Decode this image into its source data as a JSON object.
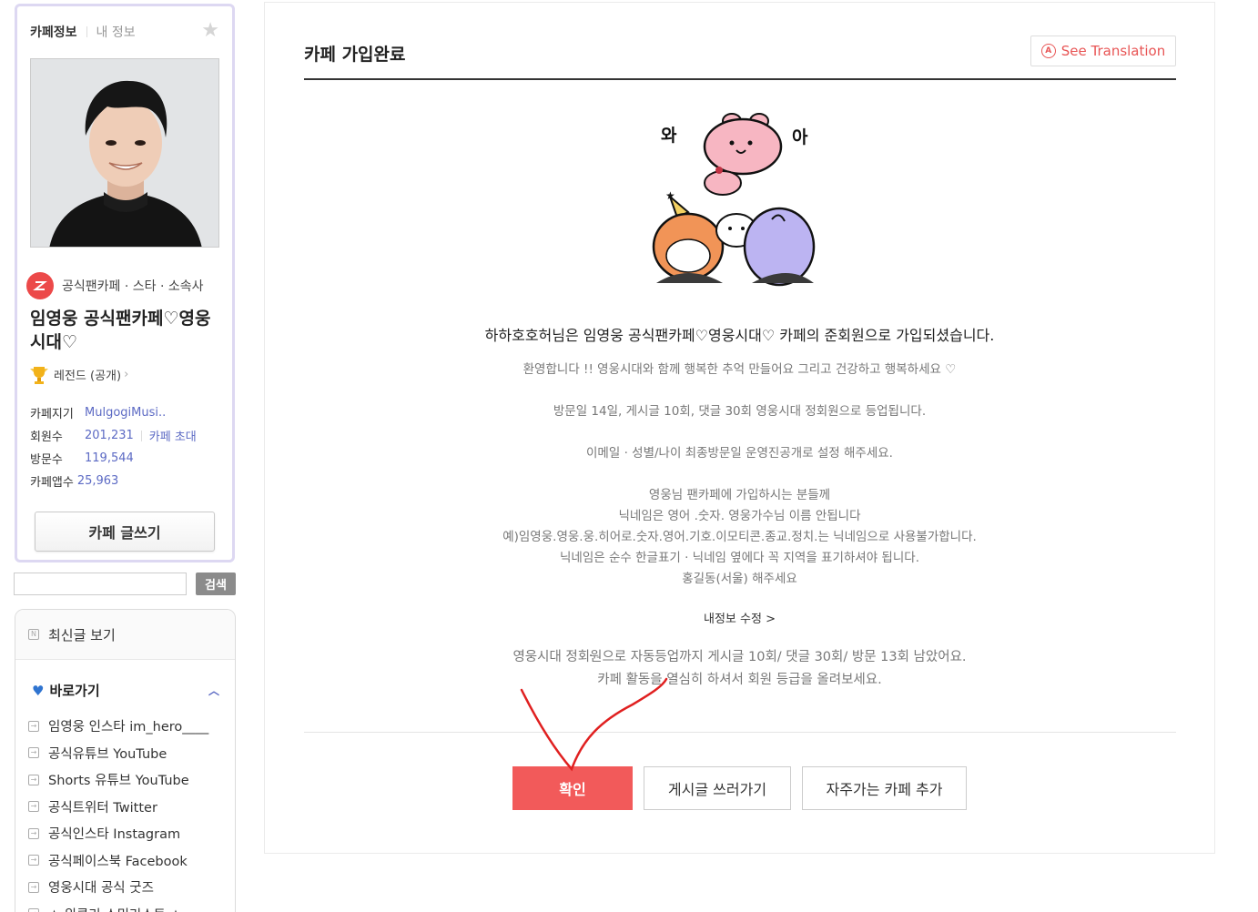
{
  "sidebar": {
    "tab_active": "카페정보",
    "tab_inactive": "내 정보",
    "category": "공식팬카페 · 스타 · 소속사",
    "cafe_name": "임영웅 공식팬카페♡영웅시대♡",
    "level": "레전드 (공개)",
    "stats": {
      "manager_label": "카페지기",
      "manager_value": "MulgogiMusi..",
      "members_label": "회원수",
      "members_value": "201,231",
      "invite_label": "카페 초대",
      "visits_label": "방문수",
      "visits_value": "119,544",
      "app_label": "카페앱수",
      "app_value": "25,963"
    },
    "write_button": "카페 글쓰기",
    "search_button": "검색",
    "search_value": "",
    "recent_posts": "최신글 보기",
    "shortcut_title": "바로가기",
    "shortcut_items": [
      "임영웅 인스타 im_hero____",
      "공식유튜브 YouTube",
      "Shorts 유튜브 YouTube",
      "공식트위터 Twitter",
      "공식인스타 Instagram",
      "공식페이스북 Facebook",
      "영웅시대 공식 굿즈",
      "★ 위클리 스밍리스트 ★"
    ]
  },
  "main": {
    "title": "카페 가입완료",
    "translate_button": "See Translation",
    "illustration_text_left": "와",
    "illustration_text_right": "아",
    "join_message": "하하호호허님은 임영웅 공식팬카페♡영웅시대♡ 카페의 준회원으로 가입되셨습니다.",
    "welcome_lines": [
      "환영합니다 !! 영웅시대와 함께 행복한 추억 만들어요 그리고 건강하고 행복하세요 ♡",
      "방문일 14일, 게시글 10회, 댓글 30회 영웅시대 정회원으로 등업됩니다.",
      "이메일 · 성별/나이 최종방문일 운영진공개로 설정 해주세요.",
      "영웅님 팬카페에 가입하시는 분들께",
      "닉네임은 영어 .숫자. 영웅가수님 이름 안됩니다",
      "예)임영웅.영웅.웅.히어로.숫자.영어.기호.이모티콘.종교.정치.는 닉네임으로 사용불가합니다.",
      "닉네임은 순수 한글표기 · 닉네임 옆에다 꼭 지역을 표기하셔야 됩니다.",
      "홍길동(서울) 해주세요"
    ],
    "edit_profile_link": "내정보 수정 >",
    "remain_lines": [
      "영웅시대 정회원으로 자동등업까지 게시글 10회/ 댓글 30회/ 방문 13회 남았어요.",
      "카페 활동을 열심히 하셔서 회원 등급을 올려보세요."
    ],
    "buttons": {
      "confirm": "확인",
      "write_post": "게시글 쓰러가기",
      "add_favorite": "자주가는 카페 추가"
    }
  },
  "colors": {
    "accent_red": "#f25a5a",
    "link_blue": "#5c6ac4",
    "card_border": "#ddd8f2",
    "annotation": "#e02020"
  }
}
